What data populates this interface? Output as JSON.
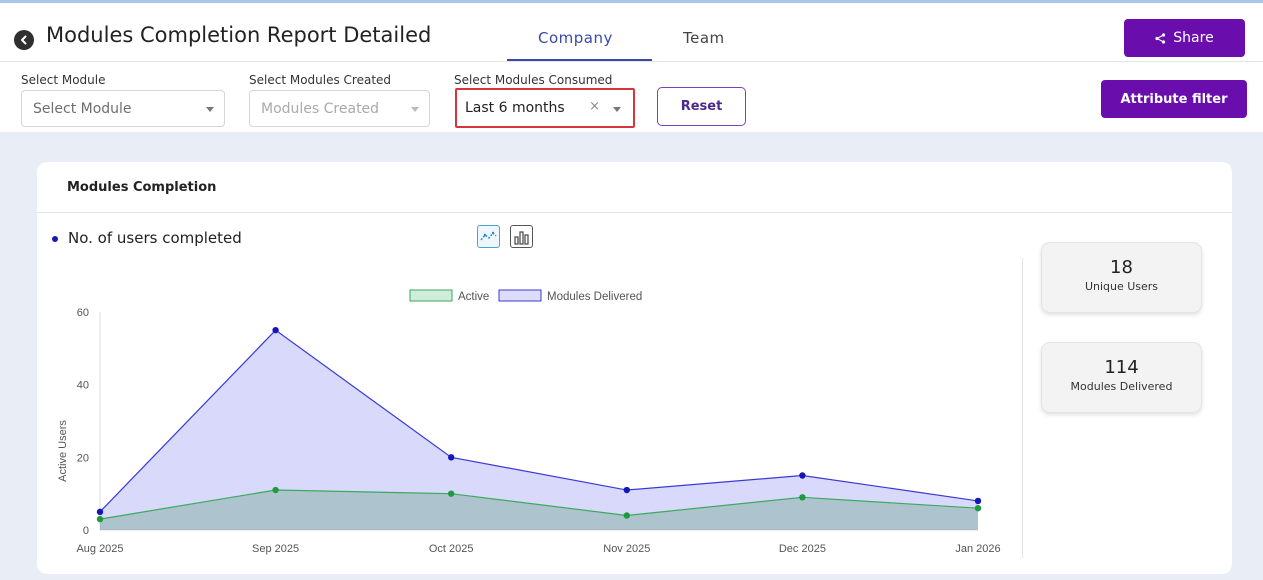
{
  "header": {
    "title": "Modules Completion Report Detailed",
    "tabs": [
      {
        "label": "Company",
        "active": true
      },
      {
        "label": "Team",
        "active": false
      }
    ],
    "share_label": "Share"
  },
  "filters": {
    "module": {
      "label": "Select Module",
      "placeholder": "Select Module"
    },
    "created": {
      "label": "Select Modules Created",
      "placeholder": "Modules Created"
    },
    "consumed": {
      "label": "Select Modules Consumed",
      "value": "Last 6 months",
      "clear_glyph": "×"
    },
    "reset_label": "Reset",
    "attribute_filter_label": "Attribute filter"
  },
  "card": {
    "title": "Modules Completion",
    "legend_label": "No. of users completed"
  },
  "stats": {
    "unique_users": {
      "value": "18",
      "label": "Unique Users"
    },
    "modules_delivered": {
      "value": "114",
      "label": "Modules Delivered"
    }
  },
  "colors": {
    "brand": "#6a0dad",
    "tab_active": "#3949ab",
    "highlight": "#d8343c",
    "series_delivered": "#3a3ad6",
    "series_active": "#3aaa5c"
  },
  "icons": {
    "back": "chevron-left-icon",
    "share": "share-icon",
    "line_chart": "line-chart-icon",
    "bar_chart": "bar-chart-icon"
  },
  "chart_data": {
    "type": "area",
    "categories": [
      "Aug 2025",
      "Sep 2025",
      "Oct 2025",
      "Nov 2025",
      "Dec 2025",
      "Jan 2026"
    ],
    "series": [
      {
        "name": "Active",
        "values": [
          3,
          11,
          10,
          4,
          9,
          6
        ]
      },
      {
        "name": "Modules Delivered",
        "values": [
          5,
          55,
          20,
          11,
          15,
          8
        ]
      }
    ],
    "ylabel": "Active Users",
    "ylim": [
      0,
      60
    ],
    "yticks": [
      0,
      20,
      40,
      60
    ],
    "legend": "top-center",
    "grid": false
  }
}
